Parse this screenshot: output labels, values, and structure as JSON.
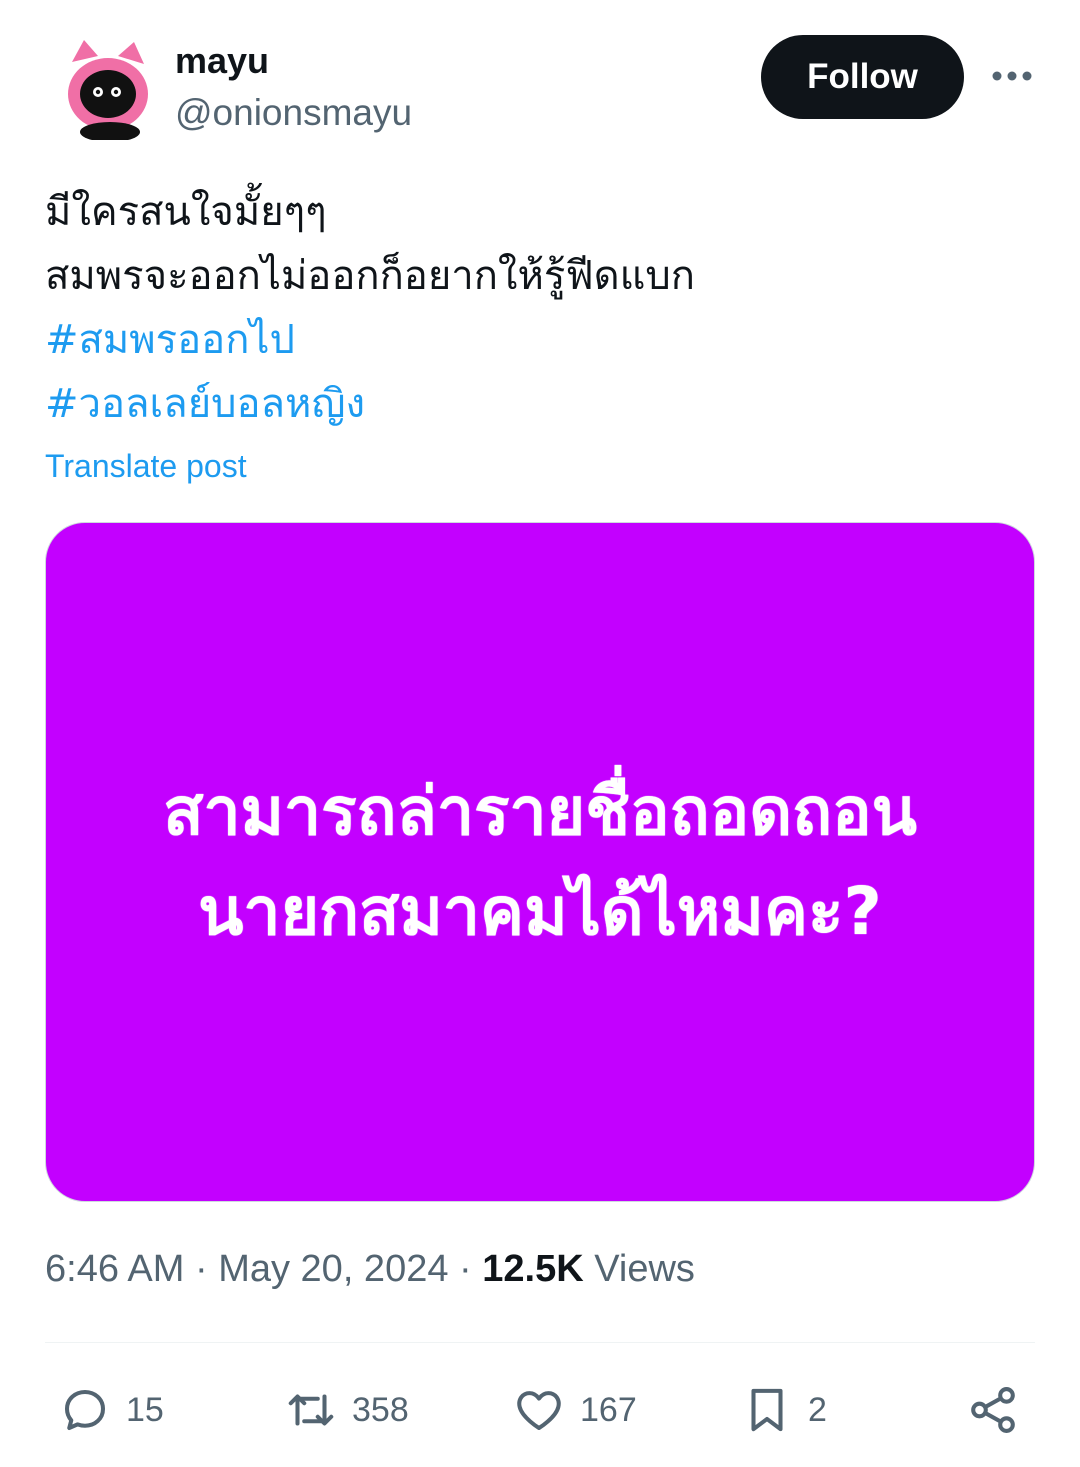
{
  "author": {
    "display_name": "mayu",
    "handle": "@onionsmayu",
    "avatar_icon": "pink-cat-avatar"
  },
  "follow_label": "Follow",
  "more_icon": "more-horizontal-icon",
  "post": {
    "line1": "มีใครสนใจมั้ยๆๆ",
    "line2": "สมพรจะออกไม่ออกก็อยากให้รู้ฟีดแบก",
    "hashtag1": "#สมพรออกไป",
    "hashtag2": "#วอลเลย์บอลหญิง",
    "translate_label": "Translate post"
  },
  "media": {
    "background_color": "#c300ff",
    "line1": "สามารถล่ารายชื่อถอดถอน",
    "line2": "นายกสมาคมได้ไหมคะ?"
  },
  "meta": {
    "time": "6:46 AM",
    "date": "May 20, 2024",
    "separator": "·",
    "views_count": "12.5K",
    "views_label": "Views"
  },
  "actions": {
    "replies": "15",
    "reposts": "358",
    "likes": "167",
    "bookmarks": "2"
  },
  "colors": {
    "accent": "#1d9bf0",
    "text_primary": "#0f1419",
    "text_secondary": "#536471"
  }
}
